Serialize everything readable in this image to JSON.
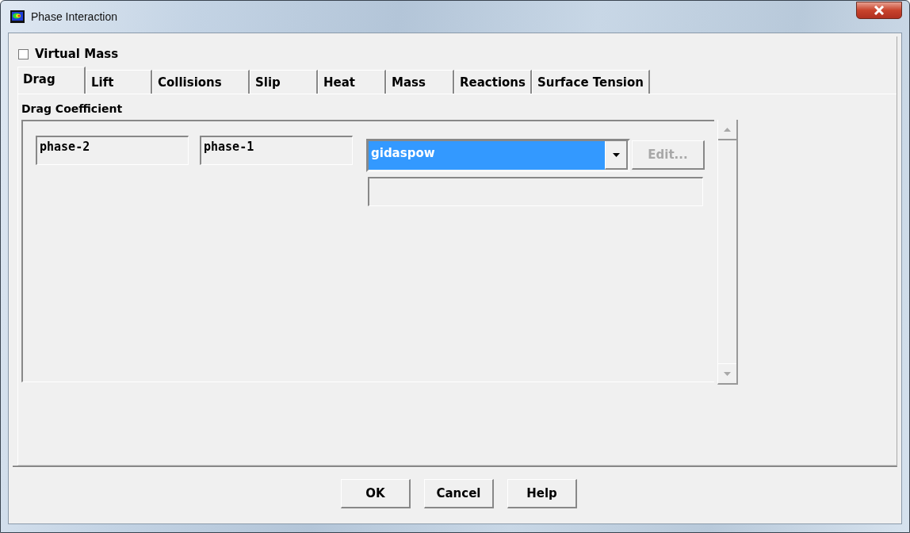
{
  "window": {
    "title": "Phase Interaction"
  },
  "virtual_mass": {
    "label": "Virtual Mass",
    "checked": false
  },
  "tabs": [
    {
      "label": "Drag",
      "selected": true
    },
    {
      "label": "Lift",
      "selected": false
    },
    {
      "label": "Collisions",
      "selected": false
    },
    {
      "label": "Slip",
      "selected": false
    },
    {
      "label": "Heat",
      "selected": false
    },
    {
      "label": "Mass",
      "selected": false
    },
    {
      "label": "Reactions",
      "selected": false
    },
    {
      "label": "Surface Tension",
      "selected": false
    }
  ],
  "drag_coefficient": {
    "label": "Drag Coefficient",
    "rows": [
      {
        "phase_a": "phase-2",
        "phase_b": "phase-1",
        "model": "gidaspow",
        "model_highlighted": true,
        "edit": {
          "label": "Edit...",
          "disabled": true
        }
      }
    ]
  },
  "buttons": [
    {
      "label": "OK"
    },
    {
      "label": "Cancel"
    },
    {
      "label": "Help"
    }
  ]
}
